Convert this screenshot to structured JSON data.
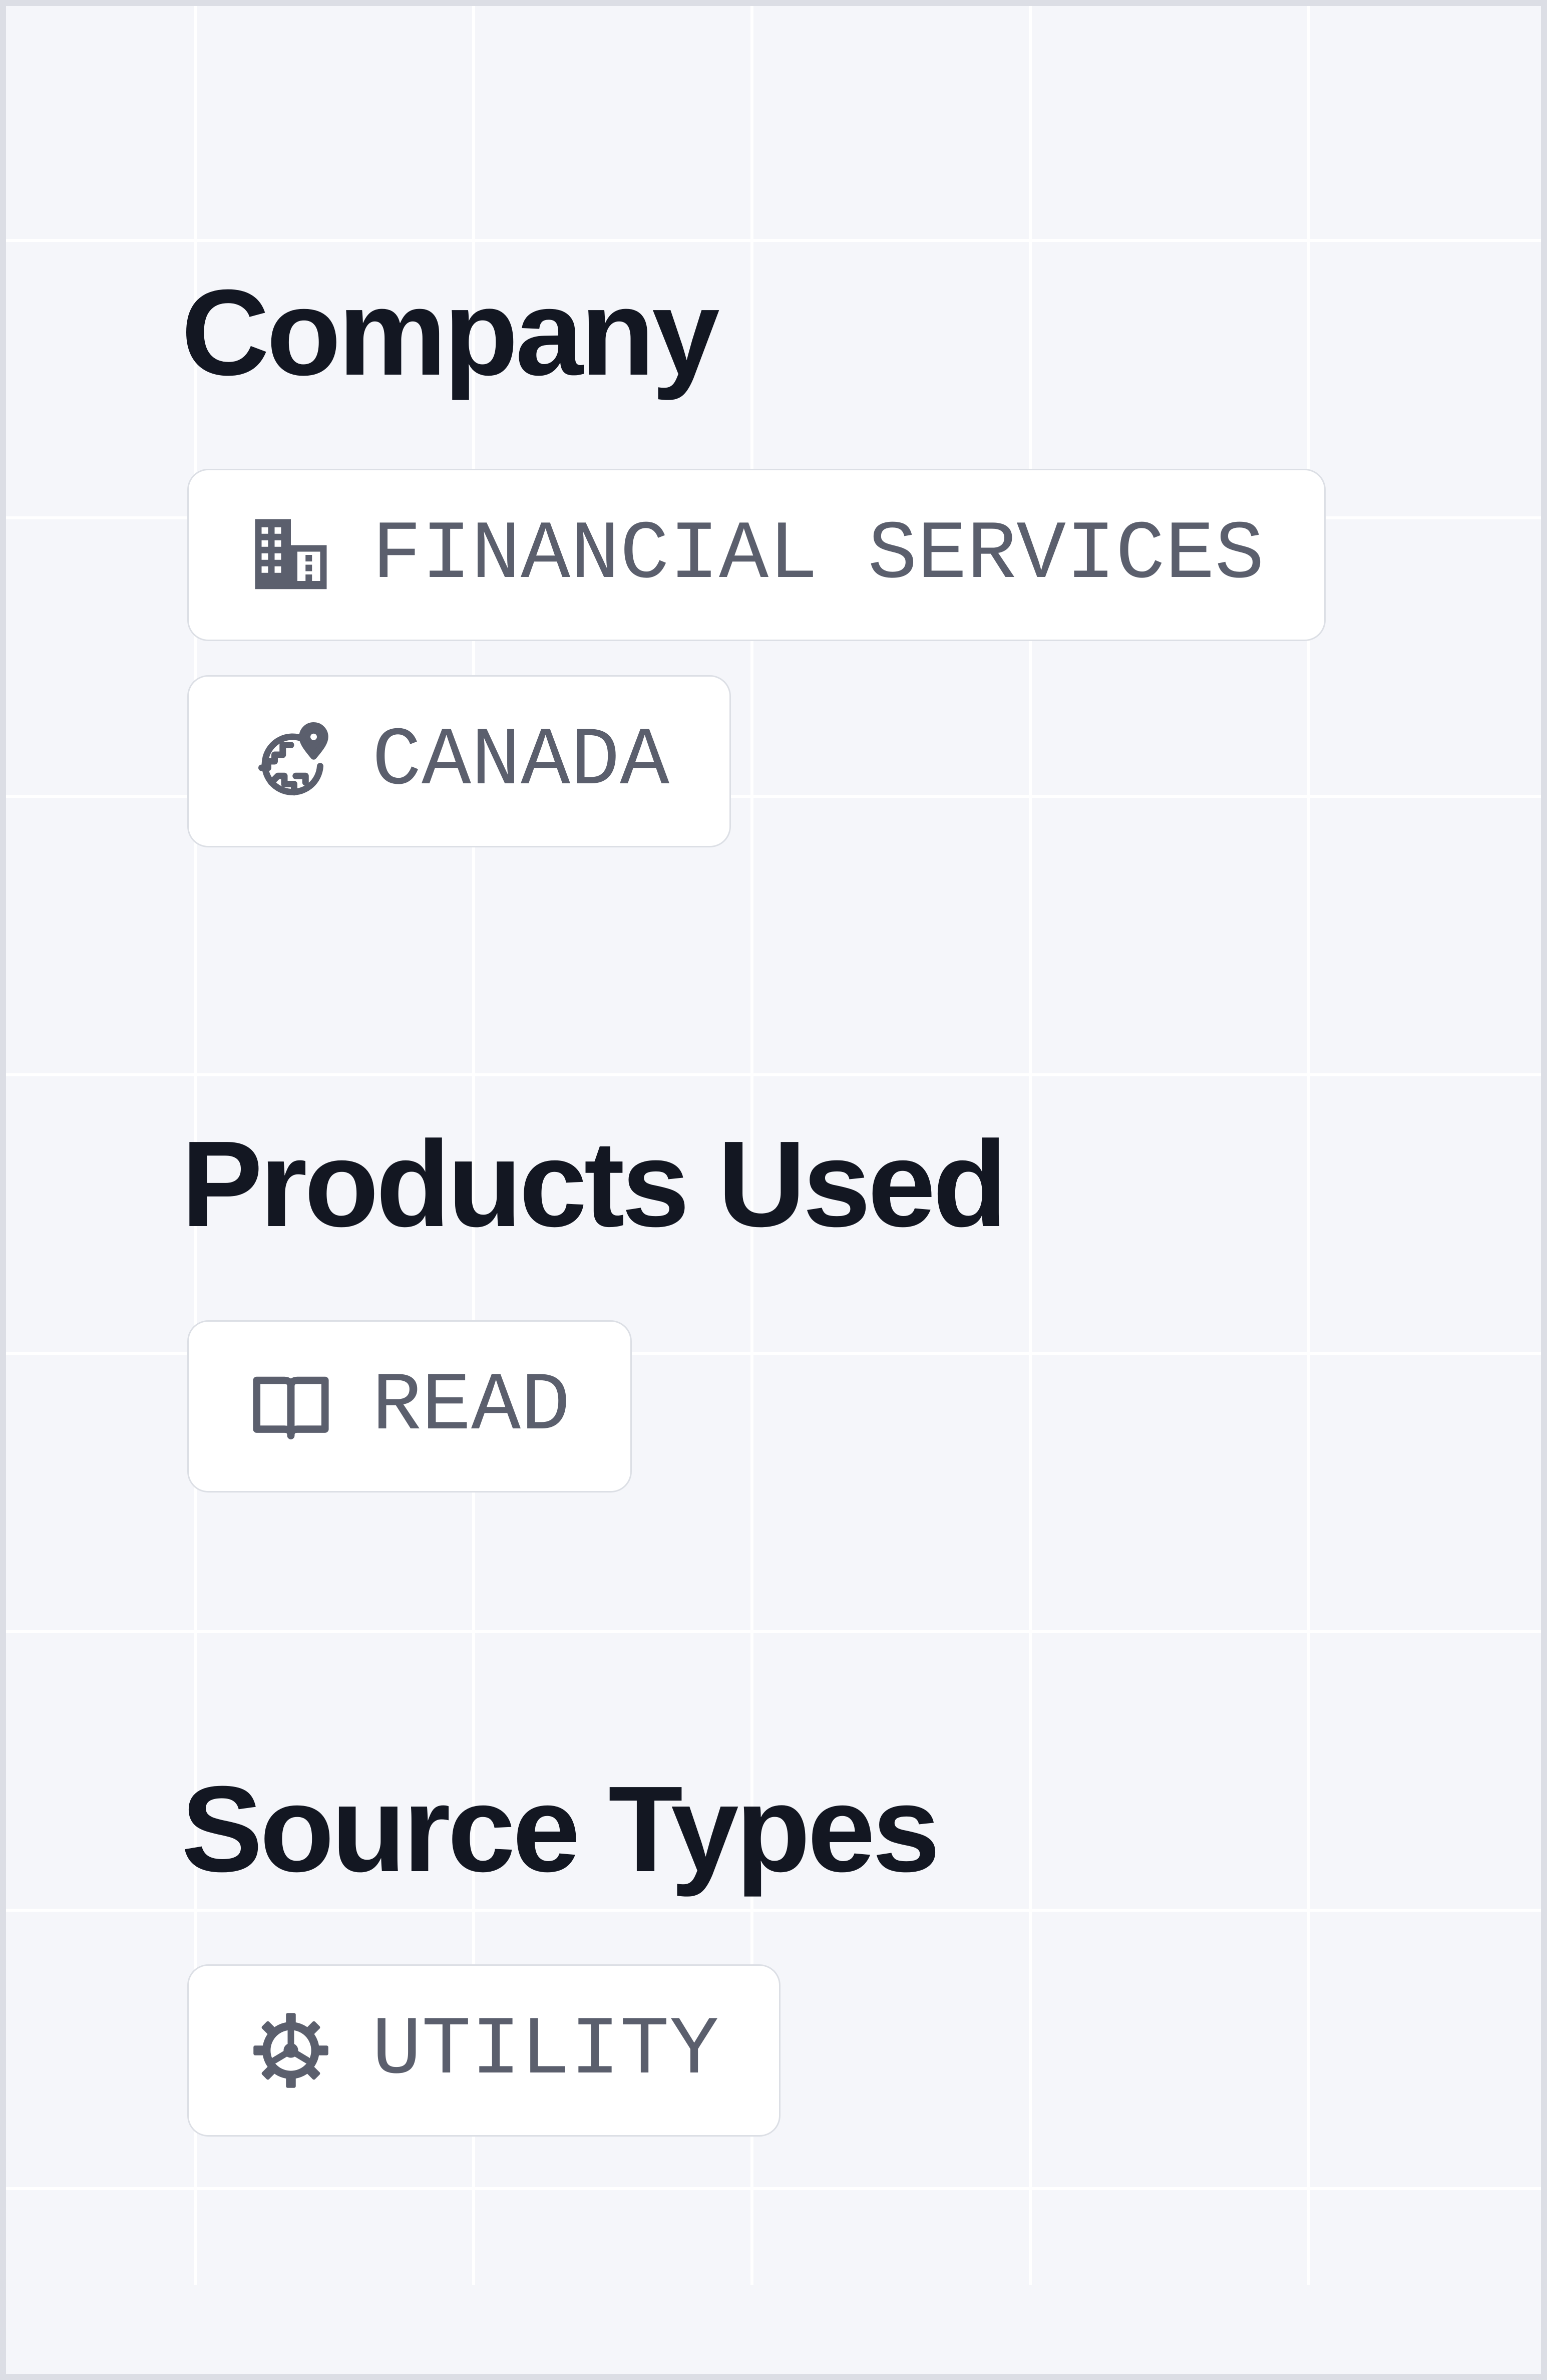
{
  "sections": {
    "company": {
      "title": "Company",
      "tags": [
        {
          "label": "FINANCIAL SERVICES",
          "icon": "building-icon"
        },
        {
          "label": "CANADA",
          "icon": "globe-location-icon"
        }
      ]
    },
    "products": {
      "title": "Products Used",
      "tags": [
        {
          "label": "READ",
          "icon": "book-icon"
        }
      ]
    },
    "sources": {
      "title": "Source Types",
      "tags": [
        {
          "label": "UTILITY",
          "icon": "gear-icon"
        }
      ]
    }
  },
  "colors": {
    "background": "#f5f6fa",
    "outer_border": "#dcdee5",
    "grid_line": "#ffffff",
    "heading": "#131722",
    "tag_text": "#5b5f6d",
    "tag_border": "#dcdfe5",
    "tag_background": "#ffffff"
  }
}
